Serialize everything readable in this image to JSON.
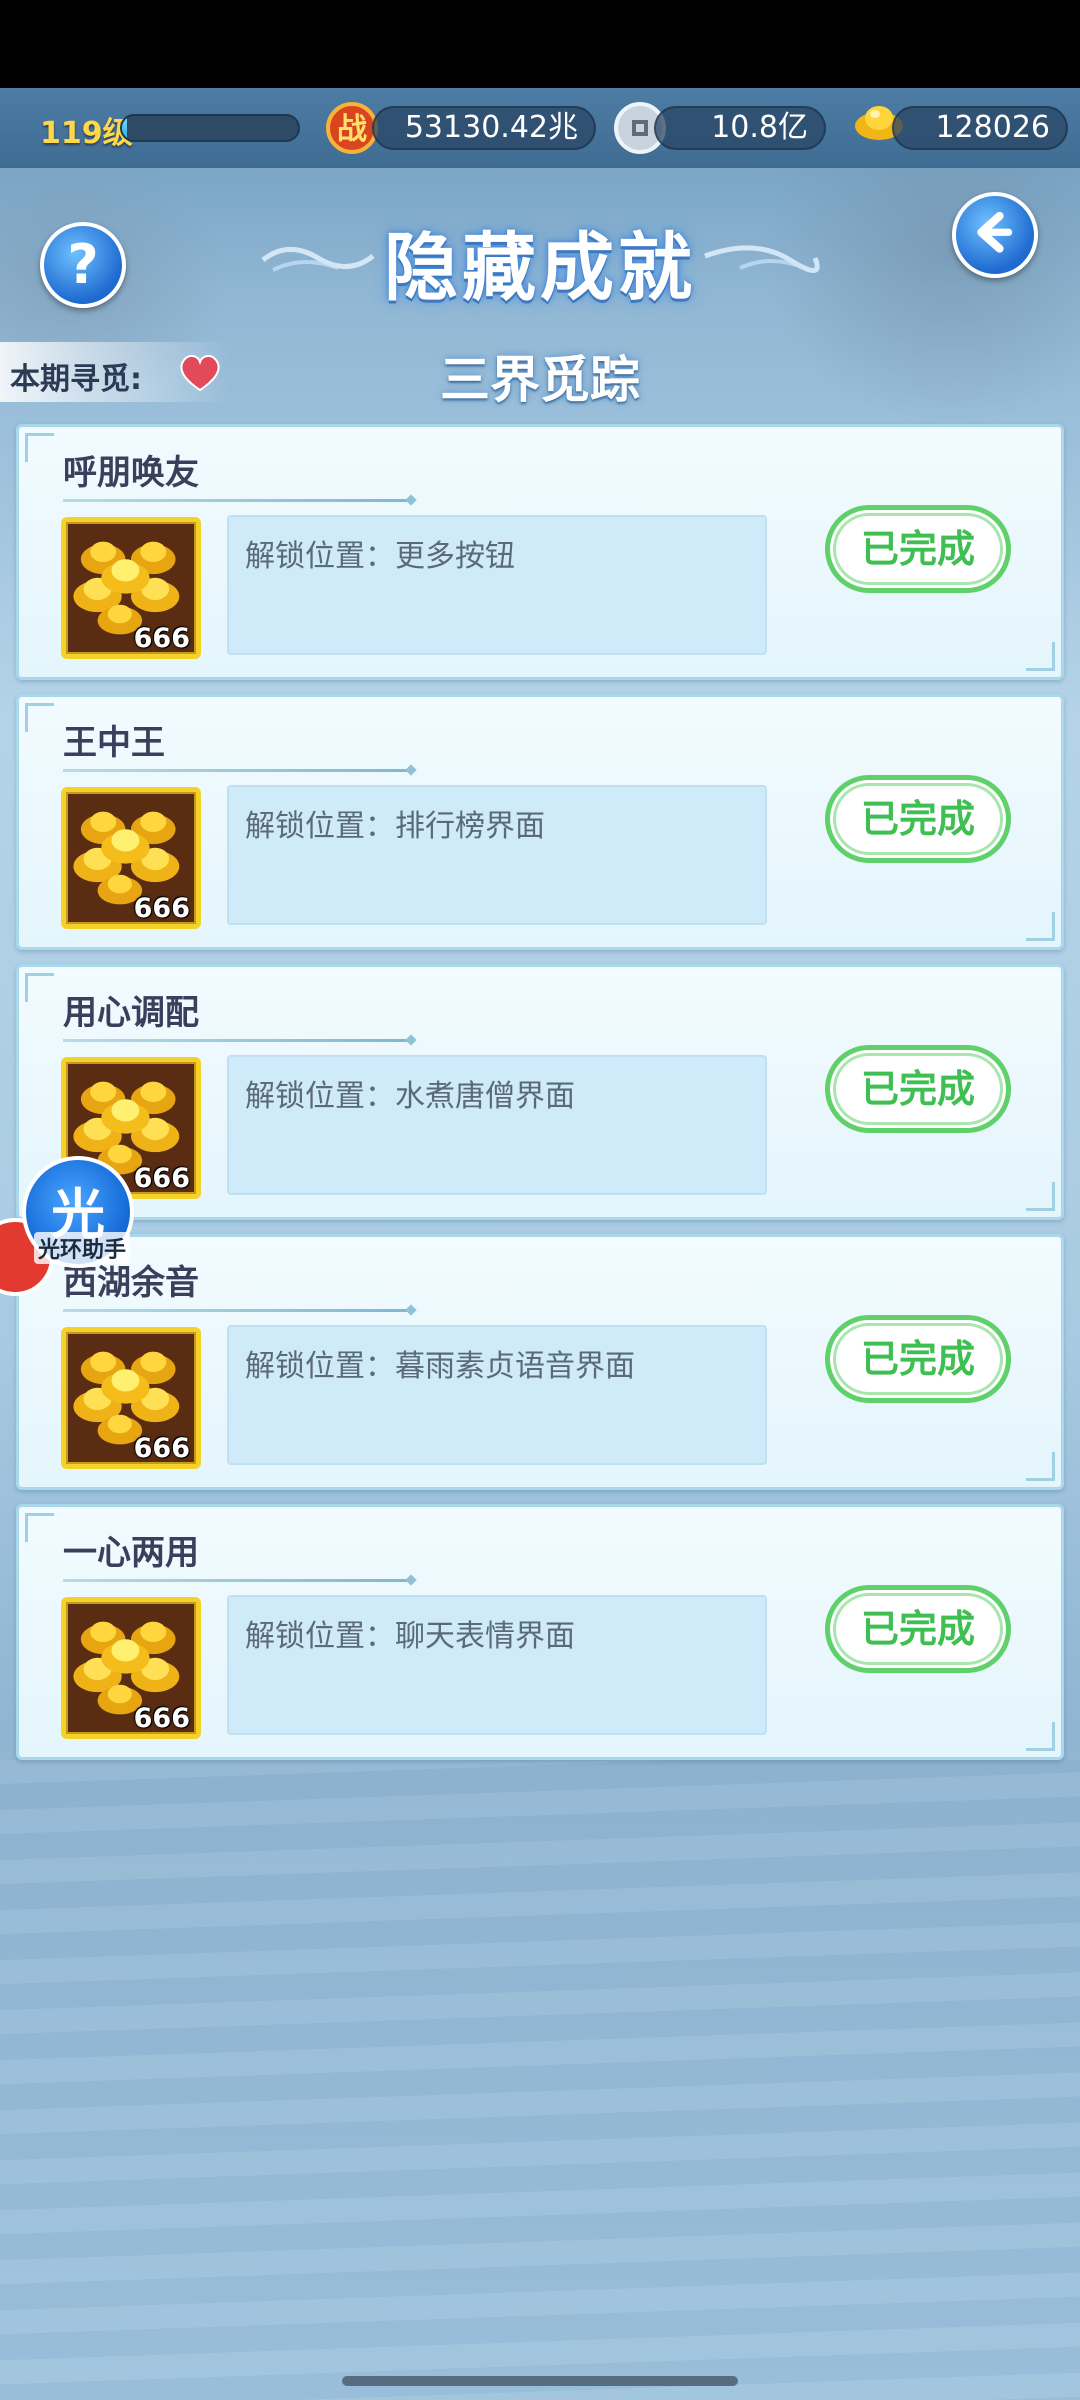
{
  "topbar": {
    "level": "119级",
    "level_progress": 0.03,
    "power_value": "53130.42兆",
    "power_icon_text": "战",
    "silver_value": "10.8亿",
    "gold_value": "128026",
    "icons": [
      "power-icon",
      "coin-icon",
      "gold-ingot-icon"
    ]
  },
  "header": {
    "title": "隐藏成就",
    "help_label": "?",
    "period_label": "本期寻觅:",
    "subtitle": "三界觅踪"
  },
  "achievements": [
    {
      "title": "呼朋唤友",
      "reward_count": "666",
      "description": "解锁位置：更多按钮",
      "status": "已完成"
    },
    {
      "title": "王中王",
      "reward_count": "666",
      "description": "解锁位置：排行榜界面",
      "status": "已完成"
    },
    {
      "title": "用心调配",
      "reward_count": "666",
      "description": "解锁位置：水煮唐僧界面",
      "status": "已完成"
    },
    {
      "title": "西湖余音",
      "reward_count": "666",
      "description": "解锁位置：暮雨素贞语音界面",
      "status": "已完成"
    },
    {
      "title": "一心两用",
      "reward_count": "666",
      "description": "解锁位置：聊天表情界面",
      "status": "已完成"
    }
  ],
  "assistant": {
    "icon_char": "光",
    "label": "光环助手"
  },
  "colors": {
    "accent_gold": "#ffd84a",
    "done_green": "#3fbf52",
    "button_blue": "#1e6ad0"
  }
}
